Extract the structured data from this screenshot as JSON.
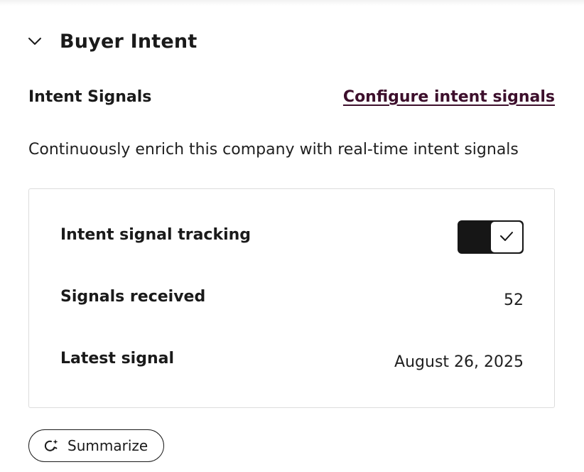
{
  "section": {
    "title": "Buyer Intent",
    "chevron_icon": "chevron-down-icon"
  },
  "intent_signals": {
    "title": "Intent Signals",
    "configure_link": "Configure intent signals",
    "link_color": "#3d0f2c",
    "description": "Continuously enrich this company with real-time intent signals"
  },
  "card": {
    "rows": [
      {
        "label": "Intent signal tracking",
        "toggle_on": true
      },
      {
        "label": "Signals received",
        "value": "52"
      },
      {
        "label": "Latest signal",
        "value": "August 26, 2025"
      }
    ]
  },
  "actions": {
    "summarize_label": "Summarize",
    "summarize_icon": "ai-sparkle-refresh-icon"
  }
}
